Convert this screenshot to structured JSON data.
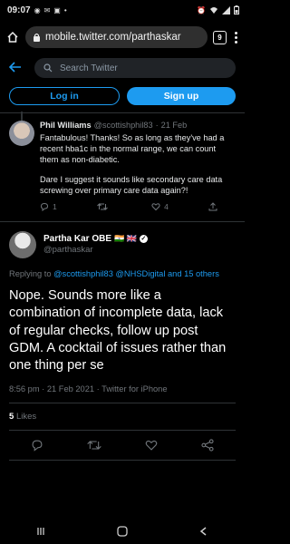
{
  "status": {
    "time": "09:07",
    "battery": "",
    "left_icons": [
      "whatsapp-icon",
      "gmail-icon",
      "photo-icon",
      "dot-icon"
    ],
    "right_icons": [
      "alarm-icon",
      "wifi-icon",
      "signal-icon",
      "battery-icon"
    ]
  },
  "browser": {
    "url": "mobile.twitter.com/parthaskar",
    "tab_count": "9"
  },
  "header": {
    "search_placeholder": "Search Twitter"
  },
  "auth": {
    "login_label": "Log in",
    "signup_label": "Sign up"
  },
  "reply_tweet": {
    "name": "Phil Williams",
    "handle": "@scottishphil83",
    "separator": "·",
    "date": "21 Feb",
    "para1": "Fantabulous! Thanks! So as long as they've had a recent hba1c in the normal range, we can count them as non-diabetic.",
    "para2": "Dare I suggest it sounds like secondary care data screwing over primary care data again?!",
    "reply_count": "1",
    "retweet_count": "",
    "like_count": "4"
  },
  "main_tweet": {
    "name": "Partha Kar OBE",
    "flags": "🇮🇳 🇬🇧",
    "handle": "@parthaskar",
    "replying_prefix": "Replying to",
    "mention1": "@scottishphil83",
    "mention2": "@NHSDigital",
    "mention_rest": "and 15 others",
    "text": "Nope. Sounds more like a combination of incomplete data, lack of regular checks, follow up post GDM. A cocktail of issues rather than one thing per se",
    "time": "8:56 pm · 21 Feb 2021 · Twitter for iPhone",
    "likes_count": "5",
    "likes_label": "Likes"
  },
  "colors": {
    "accent": "#1d9bf0",
    "background": "#000000",
    "muted": "#71767b"
  }
}
